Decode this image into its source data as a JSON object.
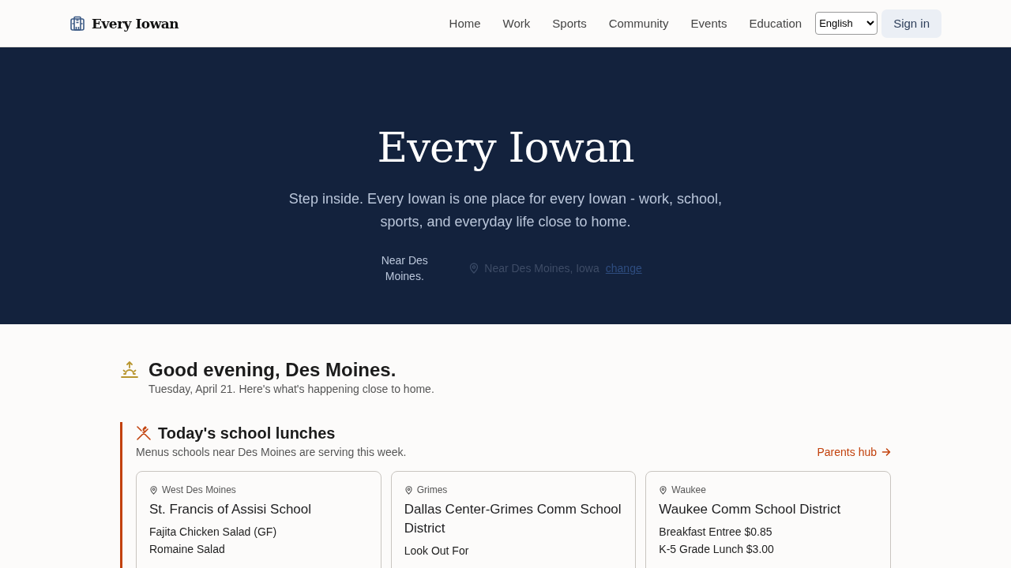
{
  "header": {
    "brand": "Every Iowan",
    "nav": [
      {
        "label": "Home"
      },
      {
        "label": "Work"
      },
      {
        "label": "Sports"
      },
      {
        "label": "Community"
      },
      {
        "label": "Events"
      },
      {
        "label": "Education"
      }
    ],
    "language": "English",
    "sign_in": "Sign in"
  },
  "hero": {
    "title": "Every Iowan",
    "subtitle": "Step inside. Every Iowan is one place for every Iowan - work, school, sports, and everyday life close to home.",
    "location_note": "Near Des Moines.",
    "location": "Near Des Moines, Iowa",
    "change_link": "change"
  },
  "greeting": {
    "title": "Good evening, Des Moines.",
    "subtitle": "Tuesday, April 21. Here's what's happening close to home."
  },
  "lunches": {
    "title": "Today's school lunches",
    "subtitle": "Menus schools near Des Moines are serving this week.",
    "link": "Parents hub",
    "cards": [
      {
        "place": "West Des Moines",
        "school": "St. Francis of Assisi School",
        "items": [
          "Fajita Chicken Salad (GF)",
          "Romaine Salad"
        ]
      },
      {
        "place": "Grimes",
        "school": "Dallas Center-Grimes Comm School District",
        "items": [
          "Look Out For"
        ]
      },
      {
        "place": "Waukee",
        "school": "Waukee Comm School District",
        "items": [
          "Breakfast Entree $0.85",
          "K-5 Grade Lunch $3.00"
        ]
      }
    ]
  }
}
